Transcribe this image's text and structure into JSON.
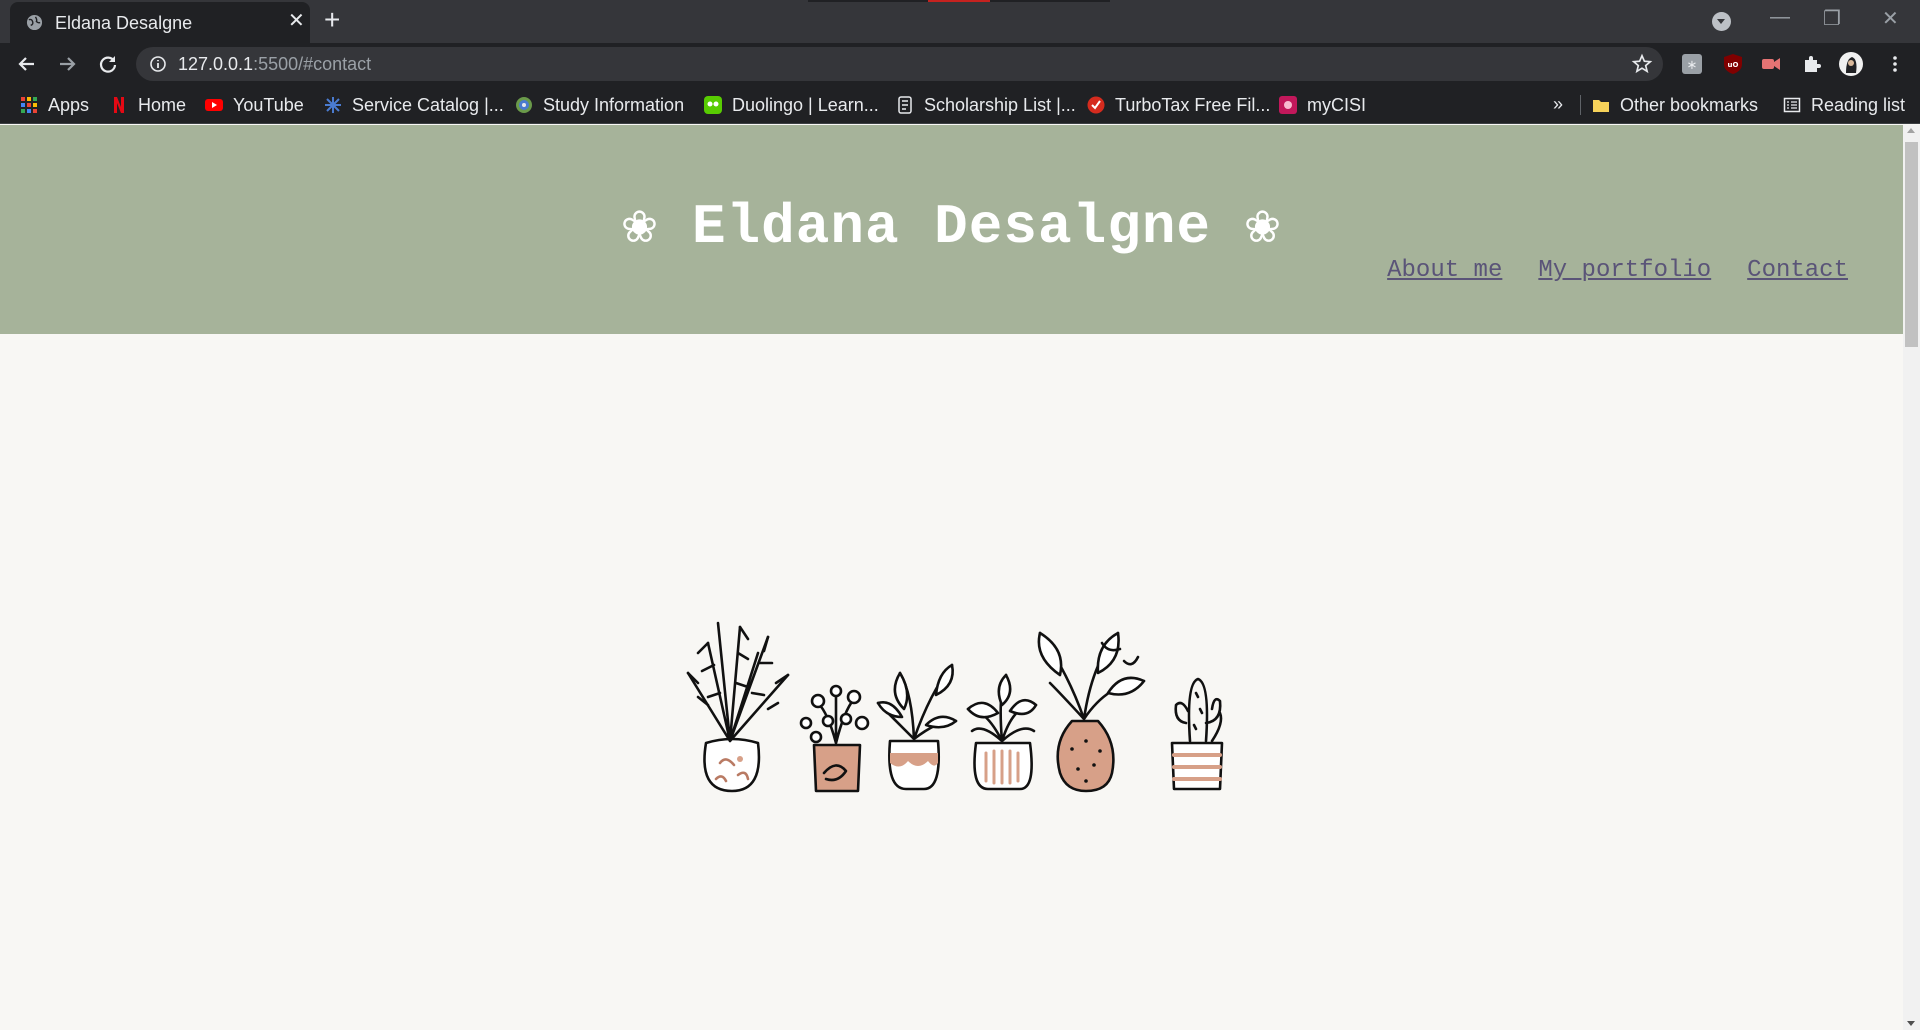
{
  "browser": {
    "tab": {
      "title": "Eldana Desalgne",
      "close": "✕"
    },
    "new_tab": "+",
    "window_controls": {
      "minimize": "—",
      "restore": "❐",
      "close": "✕"
    },
    "address": {
      "host": "127.0.0.1",
      "path": ":5500/#contact"
    },
    "bookmarks": [
      {
        "label": "Apps",
        "icon": "apps-grid-icon"
      },
      {
        "label": "Home",
        "icon": "netflix-icon"
      },
      {
        "label": "YouTube",
        "icon": "youtube-icon"
      },
      {
        "label": "Service Catalog |...",
        "icon": "service-catalog-icon"
      },
      {
        "label": "Study Information",
        "icon": "study-globe-icon"
      },
      {
        "label": "Duolingo | Learn...",
        "icon": "duolingo-icon"
      },
      {
        "label": "Scholarship List |...",
        "icon": "scholarship-icon"
      },
      {
        "label": "TurboTax Free Fil...",
        "icon": "turbotax-icon"
      },
      {
        "label": "myCISI",
        "icon": "mycisi-icon"
      }
    ],
    "bookmarks_overflow": "»",
    "other_bookmarks": "Other bookmarks",
    "reading_list": "Reading list"
  },
  "page": {
    "title": "❀ Eldana Desalgne ❀",
    "nav": [
      "About me",
      "My portfolio",
      "Contact"
    ]
  },
  "colors": {
    "header_bg": "#a6b39a",
    "page_bg": "#f8f7f4",
    "link": "#5a5478",
    "pot_terracotta": "#d7a088"
  }
}
